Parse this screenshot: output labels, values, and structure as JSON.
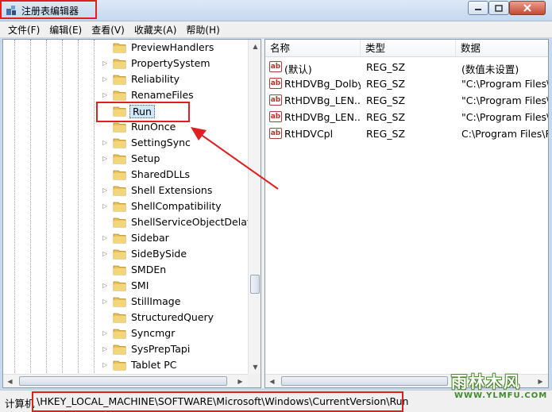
{
  "window": {
    "title": "注册表编辑器"
  },
  "menu": [
    "文件(F)",
    "编辑(E)",
    "查看(V)",
    "收藏夹(A)",
    "帮助(H)"
  ],
  "tree": {
    "items": [
      {
        "label": "PreviewHandlers",
        "expandable": false
      },
      {
        "label": "PropertySystem",
        "expandable": true
      },
      {
        "label": "Reliability",
        "expandable": true
      },
      {
        "label": "RenameFiles",
        "expandable": true
      },
      {
        "label": "Run",
        "expandable": false,
        "selected": true
      },
      {
        "label": "RunOnce",
        "expandable": false
      },
      {
        "label": "SettingSync",
        "expandable": true
      },
      {
        "label": "Setup",
        "expandable": true
      },
      {
        "label": "SharedDLLs",
        "expandable": false
      },
      {
        "label": "Shell Extensions",
        "expandable": true
      },
      {
        "label": "ShellCompatibility",
        "expandable": true
      },
      {
        "label": "ShellServiceObjectDelayLo",
        "expandable": false
      },
      {
        "label": "Sidebar",
        "expandable": true
      },
      {
        "label": "SideBySide",
        "expandable": true
      },
      {
        "label": "SMDEn",
        "expandable": false
      },
      {
        "label": "SMI",
        "expandable": true
      },
      {
        "label": "StillImage",
        "expandable": true
      },
      {
        "label": "StructuredQuery",
        "expandable": false
      },
      {
        "label": "Syncmgr",
        "expandable": true
      },
      {
        "label": "SysPrepTapi",
        "expandable": true
      },
      {
        "label": "Tablet PC",
        "expandable": true
      }
    ]
  },
  "list": {
    "columns": [
      "名称",
      "类型",
      "数据"
    ],
    "rows": [
      {
        "name": "(默认)",
        "type": "REG_SZ",
        "data": "(数值未设置)"
      },
      {
        "name": "RtHDVBg_Dolby",
        "type": "REG_SZ",
        "data": "\"C:\\Program Files\\"
      },
      {
        "name": "RtHDVBg_LEN...",
        "type": "REG_SZ",
        "data": "\"C:\\Program Files\\"
      },
      {
        "name": "RtHDVBg_LEN...",
        "type": "REG_SZ",
        "data": "\"C:\\Program Files\\"
      },
      {
        "name": "RtHDVCpl",
        "type": "REG_SZ",
        "data": "C:\\Program Files\\R"
      }
    ]
  },
  "status": {
    "label": "计算机",
    "path": "\\HKEY_LOCAL_MACHINE\\SOFTWARE\\Microsoft\\Windows\\CurrentVersion\\Run"
  },
  "watermark": {
    "line1": "雨林木风",
    "line2": "WWW.YLMFU.COM"
  },
  "colors": {
    "annotation_red": "#e02020",
    "selection": "#cde8ff",
    "folder": "#e8c25a"
  }
}
